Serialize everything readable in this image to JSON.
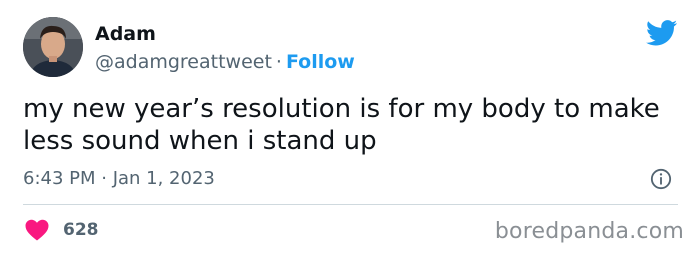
{
  "author": {
    "name": "Adam",
    "handle": "@adamgreattweet",
    "separator": "·",
    "follow_label": "Follow"
  },
  "tweet": {
    "text": "my new year’s resolution is for my body to make less sound when i stand up",
    "time": "6:43 PM · Jan 1, 2023"
  },
  "engagement": {
    "likes": "628"
  },
  "watermark": "boredpanda.com",
  "icons": {
    "brand": "twitter-bird-icon",
    "info": "info-icon",
    "like": "heart-icon"
  },
  "colors": {
    "accent": "#1d9bf0",
    "like": "#f91880",
    "secondary_text": "#536471",
    "divider": "#cfd9de"
  }
}
